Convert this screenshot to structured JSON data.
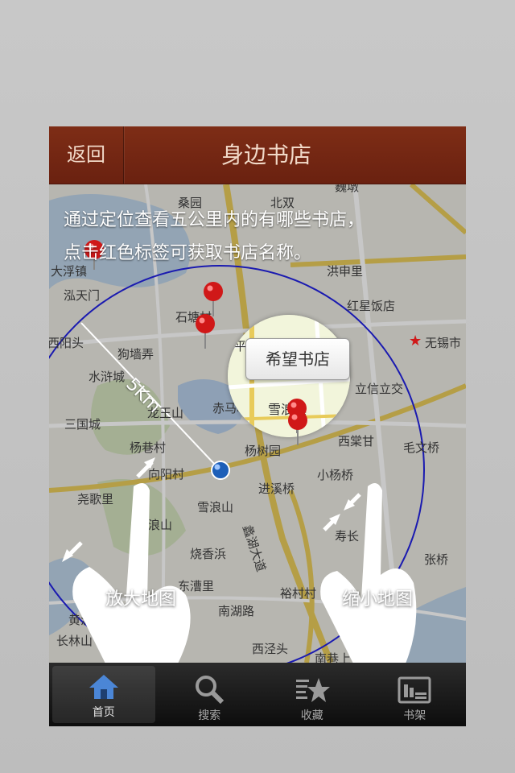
{
  "header": {
    "back_label": "返回",
    "title": "身边书店"
  },
  "overlay": {
    "line1": "通过定位查看五公里内的有哪些书店，",
    "line2": "点击红色标签可获取书店名称。",
    "radius": "5Km"
  },
  "callout": {
    "bookstore_name": "希望书店"
  },
  "gestures": {
    "zoom_in": "放大地图",
    "zoom_out": "缩小地图"
  },
  "map_labels": {
    "l1": "桑园",
    "l2": "北双",
    "l3": "巍墩",
    "l4": "大浮镇",
    "l5": "洪申里",
    "l6": "泓天门",
    "l7": "石塘村",
    "l8": "红星饭店",
    "l9": "西阳头",
    "l10": "狗墙弄",
    "l11": "无锡市",
    "l12": "水浒城",
    "l13": "立信立交",
    "l14": "龙王山",
    "l15": "赤马咀",
    "l16": "雪浪镇",
    "l17": "三国城",
    "l18": "杨巷村",
    "l19": "杨树园",
    "l20": "西棠甘",
    "l21": "毛文桥",
    "l22": "向阳村",
    "l23": "小杨桥",
    "l24": "尧歌里",
    "l25": "雪浪山",
    "l26": "进溪桥",
    "l27": "西浪山",
    "l28": "寿长",
    "l29": "张桥",
    "l30": "烧香浜",
    "l31": "蠡湖大道",
    "l32": "东漕里",
    "l33": "裕村村",
    "l34": "黄泥头",
    "l35": "南湖路",
    "l36": "长林山",
    "l37": "西泾头",
    "l38": "南巷上",
    "l39": "平"
  },
  "tabs": [
    {
      "label": "首页",
      "icon": "home-icon"
    },
    {
      "label": "搜索",
      "icon": "search-icon"
    },
    {
      "label": "收藏",
      "icon": "favorites-icon"
    },
    {
      "label": "书架",
      "icon": "bookshelf-icon"
    }
  ],
  "colors": {
    "header": "#742714",
    "header_text": "#f1d9c8",
    "radius_circle": "#1a1ab0",
    "pin": "#d01818",
    "location_dot": "#1d5fb8"
  }
}
